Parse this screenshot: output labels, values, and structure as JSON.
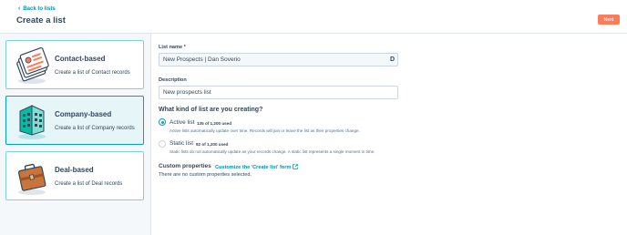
{
  "header": {
    "back_label": "Back to lists",
    "title": "Create a list",
    "next_label": "Next"
  },
  "sidebar": {
    "cards": [
      {
        "title": "Contact-based",
        "description": "Create a list of Contact records",
        "selected": false,
        "icon": "contact-cards-icon"
      },
      {
        "title": "Company-based",
        "description": "Create a list of Company records",
        "selected": true,
        "icon": "company-building-icon"
      },
      {
        "title": "Deal-based",
        "description": "Create a list of Deal records",
        "selected": false,
        "icon": "deal-briefcase-icon"
      }
    ]
  },
  "form": {
    "list_name_label": "List name *",
    "list_name_value": "New Prospects | Dan Soverio",
    "description_label": "Description",
    "description_value": "New prospects list",
    "kind_heading": "What kind of list are you creating?",
    "options": [
      {
        "label": "Active list",
        "meta": "135 of 1,200 used",
        "help": "Active lists automatically update over time. Records will join or leave the list as their properties change.",
        "checked": true
      },
      {
        "label": "Static list",
        "meta": "92 of 1,200 used",
        "help": "Static lists do not automatically update as your records change. A static list represents a single moment in time.",
        "checked": false
      }
    ],
    "custom_heading": "Custom properties",
    "custom_link": "Customize the 'Create list' form",
    "no_properties": "There are no custom properties selected."
  },
  "colors": {
    "accent": "#00a4bd",
    "link": "#0091ae",
    "primary_button": "#ff7a59",
    "text": "#33475b",
    "selected_card_bg": "#e5f5f8"
  }
}
